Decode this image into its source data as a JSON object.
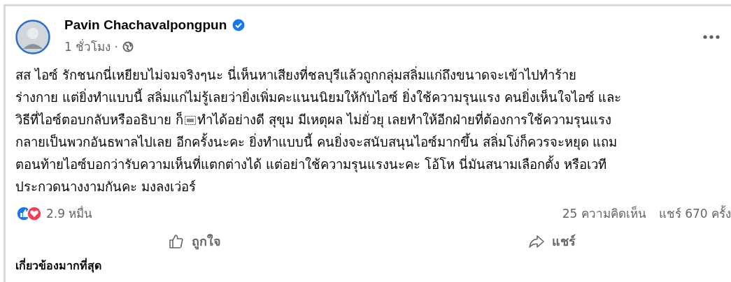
{
  "post": {
    "author": "Pavin Chachavalpongpun",
    "verified": true,
    "time": "1 ชั่วโมง ·",
    "lines": [
      "สส ไอซ์ รักชนกนี่เหยียบไม่จมจริงๆนะ นี่เห็นหาเสียงที่ชลบุรีแล้วถูกกลุ่มสลิ่มแก่ถึงขนาดจะเข้าไปทำร้าย",
      "ร่างกาย แต่ยิ่งทำแบบนี้ สลิ่มแก่ไม่รู้เลยว่ายิ่งเพิ่มคะแนนนิยมให้กับไอซ์ ยิ่งใช้ความรุนแรง คนยิ่งเห็นใจไอซ์ และ",
      [
        "วิธีที่ไอซ์ตอบกลับหรืออธิบาย ก็",
        "ทำได้อย่างดี สุขุม มีเหตุผล ไม่ยั่วยุ เลยทำให้อีกฝ่ายที่ต้องการใช้ความรุนแรง"
      ],
      "กลายเป็นพวกอันธพาลไปเลย อีกครั้งนะคะ ยิ่งทำแบบนี้ คนยิ่งจะสนับสนุนไอซ์มากขึ้น สลิ่มโง่ก็ควรจะหยุด แถม",
      "ตอนท้ายไอซ์บอกว่ารับความเห็นที่แตกต่างได้ แต่อย่าใช้ความรุนแรงนะคะ โอ้โห นี่มันสนามเลือกตั้ง หรือเวที",
      "ประกวดนางงามกันคะ มงลงเว่อร์"
    ],
    "reactions": "2.9 หมื่น",
    "comments": "25 ความคิดเห็น",
    "shares": "แชร์ 670 ครั้ง",
    "actions": [
      {
        "kind": "like",
        "label": "ถูกใจ"
      },
      {
        "kind": "share",
        "label": "แชร์"
      }
    ],
    "sort": "เกี่ยวข้องมากที่สุด"
  }
}
